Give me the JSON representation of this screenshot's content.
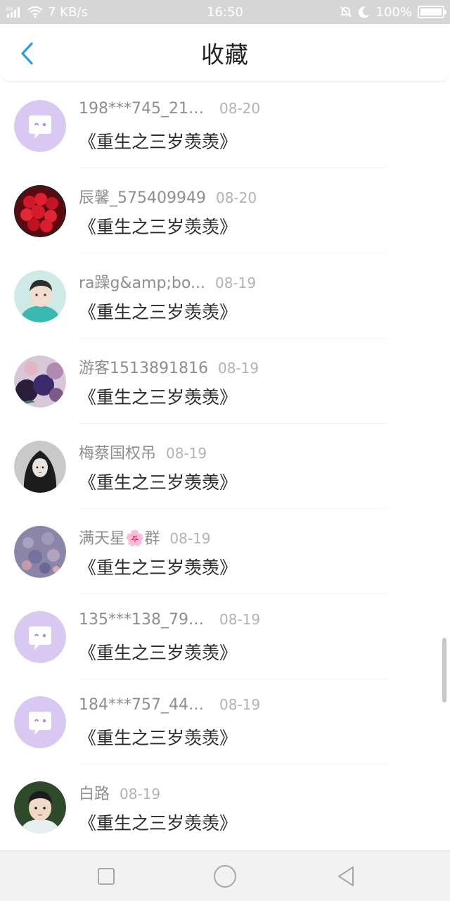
{
  "status_bar": {
    "network": "4G",
    "speed": "7 KB/s",
    "time": "16:50",
    "battery": "100%"
  },
  "header": {
    "title": "收藏",
    "back_icon": "chevron-left-icon",
    "accent_color": "#2f9be0"
  },
  "items": [
    {
      "username": "198***745_211...",
      "date": "08-20",
      "title": "《重生之三岁羡羡》",
      "avatar": "default-chat-bubble"
    },
    {
      "username": "辰馨_575409949",
      "date": "08-20",
      "title": "《重生之三岁羡羡》",
      "avatar": "roses-photo"
    },
    {
      "username": "ra躁g&amp;bo...",
      "date": "08-19",
      "title": "《重生之三岁羡羡》",
      "avatar": "portrait-photo"
    },
    {
      "username": "游客1513891816",
      "date": "08-19",
      "title": "《重生之三岁羡羡》",
      "avatar": "balloons-photo"
    },
    {
      "username": "梅蔡国权吊",
      "date": "08-19",
      "title": "《重生之三岁羡羡》",
      "avatar": "anime-girl-photo"
    },
    {
      "username": "满天星🌸群",
      "date": "08-19",
      "title": "《重生之三岁羡羡》",
      "avatar": "flowers-field-photo"
    },
    {
      "username": "135***138_795...",
      "date": "08-19",
      "title": "《重生之三岁羡羡》",
      "avatar": "default-chat-bubble"
    },
    {
      "username": "184***757_448...",
      "date": "08-19",
      "title": "《重生之三岁羡羡》",
      "avatar": "default-chat-bubble"
    },
    {
      "username": "白路",
      "date": "08-19",
      "title": "《重生之三岁羡羡》",
      "avatar": "child-photo"
    }
  ],
  "nav_bar": {
    "recent_icon": "square-icon",
    "home_icon": "circle-icon",
    "back_icon": "triangle-back-icon"
  }
}
